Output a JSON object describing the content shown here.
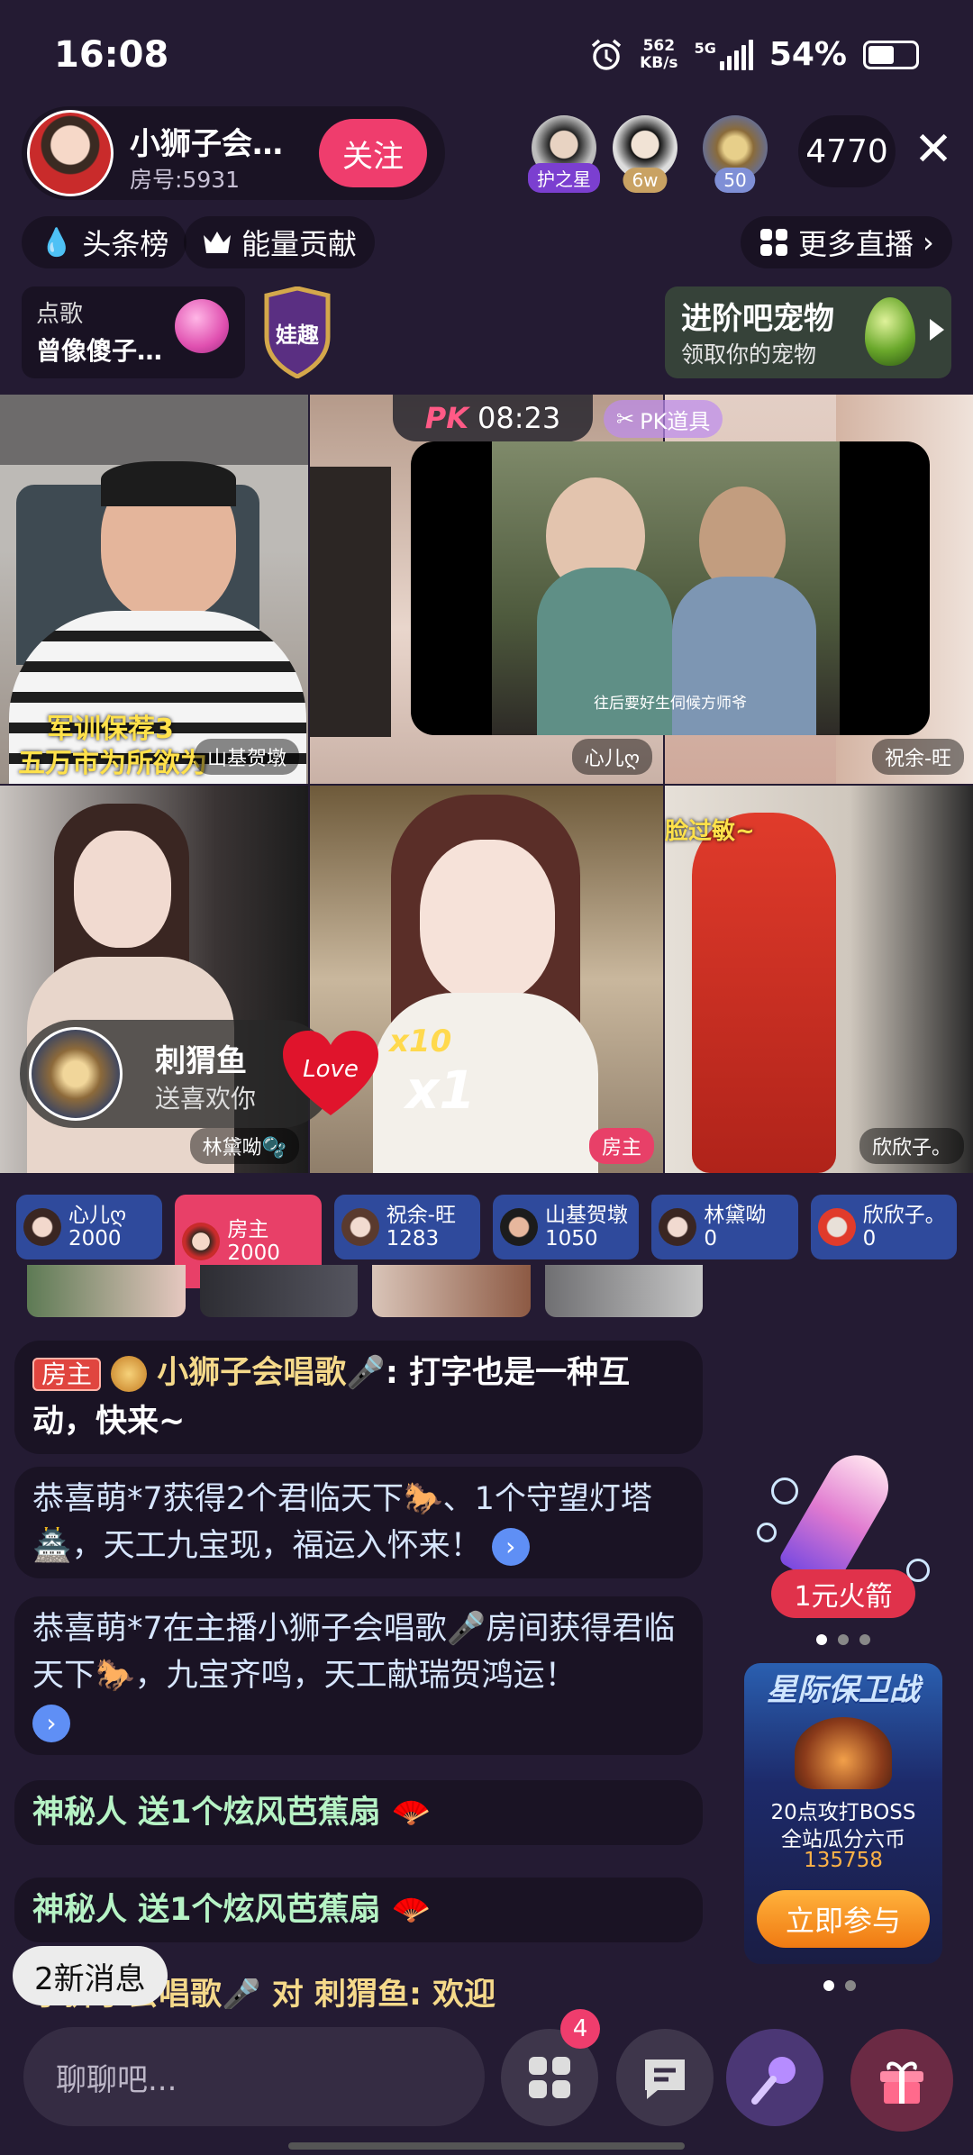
{
  "status": {
    "time": "16:08",
    "net_speed": "562",
    "net_unit": "KB/s",
    "signal_type": "5G",
    "battery": "54%"
  },
  "host": {
    "name": "小狮子会唱歌",
    "room": "房号:5931",
    "follow_label": "关注"
  },
  "viewers": [
    {
      "badge": "护之星"
    },
    {
      "badge": "6w"
    },
    {
      "badge": "50"
    }
  ],
  "viewer_count": "4770",
  "chips": {
    "headline": "头条榜",
    "energy": "能量贡献",
    "more_live": "更多直播"
  },
  "song_tile": {
    "title": "点歌",
    "song": "曾像傻子一样"
  },
  "badge_text": "娃趣",
  "pet_promo": {
    "title": "进阶吧宠物",
    "subtitle": "领取你的宠物"
  },
  "pk": {
    "logo": "PK",
    "timer": "08:23",
    "tools": "PK道具"
  },
  "streams": [
    {
      "name": "山基贺墩",
      "overlay": "军训保荐3",
      "overlay2": "五万市为所欲为"
    },
    {
      "name": "心儿ღ",
      "subtitle": "往后要好生伺候方师爷"
    },
    {
      "name": "祝余-旺"
    },
    {
      "name": "林黛呦🫧"
    },
    {
      "name": "房主"
    },
    {
      "name": "欣欣子。",
      "overlay": "脸过敏~"
    }
  ],
  "gift_popup": {
    "sender": "刺猬鱼",
    "action": "送喜欢你",
    "gift_text": "Love",
    "count": "x10",
    "combo": "x1"
  },
  "scores": [
    {
      "name": "心儿ღ",
      "score": "2000"
    },
    {
      "name": "房主",
      "score": "2000"
    },
    {
      "name": "祝余-旺",
      "score": "1283"
    },
    {
      "name": "山基贺墩",
      "score": "1050"
    },
    {
      "name": "林黛呦",
      "score": "0"
    },
    {
      "name": "欣欣子。",
      "score": "0"
    }
  ],
  "chat": {
    "msg1_tag": "房主",
    "msg1_user": "小狮子会唱歌🎤",
    "msg1_text": ": 打字也是一种互动，快来~",
    "msg2_a": "恭喜萌*7获得2个君临天下",
    "msg2_b": "、1个守望灯塔",
    "msg2_c": "，天工九宝现，福运入怀来！",
    "msg3_a": "恭喜萌*7在主播小狮子会唱歌🎤房间获得君临天下",
    "msg3_b": "，九宝齐鸣，天工献瑞贺鸿运！",
    "msg4": "神秘人 送1个炫风芭蕉扇",
    "msg5": "神秘人 送1个炫风芭蕉扇",
    "msg6": "小狮子会唱歌🎤 对 刺猬鱼: 欢迎",
    "new_msgs": "2新消息"
  },
  "rocket": {
    "label": "1元火箭"
  },
  "event": {
    "title": "星际保卫战",
    "line1": "20点攻打BOSS",
    "line2": "全站瓜分六币",
    "number": "135758",
    "cta": "立即参与"
  },
  "input": {
    "placeholder": "聊聊吧..."
  },
  "menu_badge": "4",
  "colors": {
    "accent": "#ef3d6d",
    "background": "#241b33",
    "score_blue": "#2f4a9c",
    "gold": "#f5d98a"
  }
}
